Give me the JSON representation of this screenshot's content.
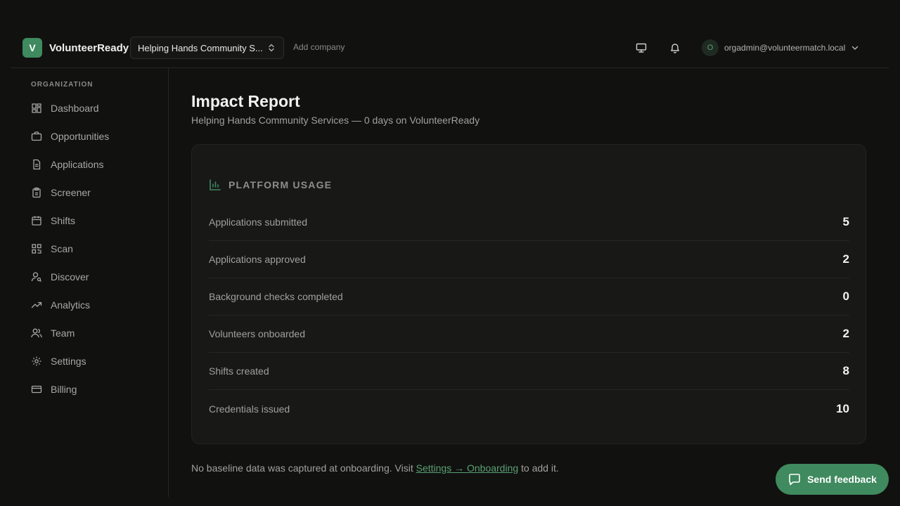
{
  "brand": {
    "logo_letter": "V",
    "name": "VolunteerReady"
  },
  "header": {
    "company_select": "Helping Hands Community S...",
    "add_company": "Add company",
    "user_initial": "O",
    "user_email": "orgadmin@volunteermatch.local"
  },
  "sidebar": {
    "section": "ORGANIZATION",
    "items": [
      {
        "label": "Dashboard",
        "icon": "dashboard-icon"
      },
      {
        "label": "Opportunities",
        "icon": "briefcase-icon"
      },
      {
        "label": "Applications",
        "icon": "document-icon"
      },
      {
        "label": "Screener",
        "icon": "clipboard-icon"
      },
      {
        "label": "Shifts",
        "icon": "calendar-icon"
      },
      {
        "label": "Scan",
        "icon": "qr-code-icon"
      },
      {
        "label": "Discover",
        "icon": "user-search-icon"
      },
      {
        "label": "Analytics",
        "icon": "trending-up-icon"
      },
      {
        "label": "Team",
        "icon": "users-icon"
      },
      {
        "label": "Settings",
        "icon": "gear-icon"
      },
      {
        "label": "Billing",
        "icon": "credit-card-icon"
      }
    ]
  },
  "main": {
    "title": "Impact Report",
    "subtitle": "Helping Hands Community Services — 0 days on VolunteerReady",
    "card": {
      "title": "PLATFORM USAGE",
      "rows": [
        {
          "label": "Applications submitted",
          "value": "5"
        },
        {
          "label": "Applications approved",
          "value": "2"
        },
        {
          "label": "Background checks completed",
          "value": "0"
        },
        {
          "label": "Volunteers onboarded",
          "value": "2"
        },
        {
          "label": "Shifts created",
          "value": "8"
        },
        {
          "label": "Credentials issued",
          "value": "10"
        }
      ]
    },
    "footnote": {
      "before": "No baseline data was captured at onboarding. Visit ",
      "link": "Settings → Onboarding",
      "after": " to add it."
    }
  },
  "feedback_button": "Send feedback",
  "colors": {
    "accent": "#3f8a5f",
    "accent_text": "#5aa173",
    "background": "#111110"
  }
}
